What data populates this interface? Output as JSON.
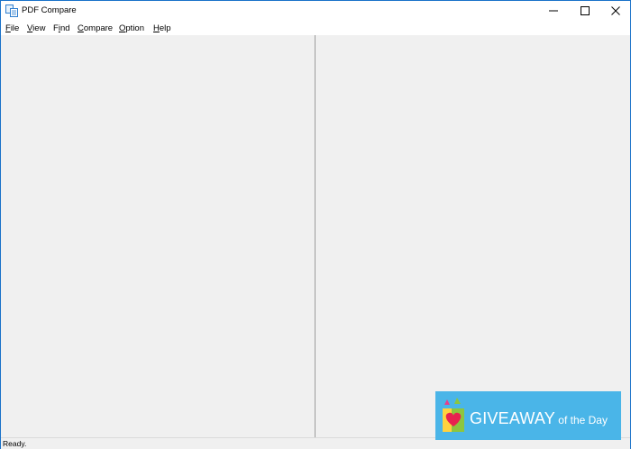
{
  "window": {
    "title": "PDF Compare",
    "accent_color": "#1a72c9",
    "app_icon": "pdf-compare-app-icon",
    "controls": [
      "minimize-icon",
      "maximize-icon",
      "close-icon"
    ]
  },
  "menu": {
    "items": [
      {
        "label": "File",
        "key": "F",
        "rest": "ile"
      },
      {
        "label": "View",
        "key": "V",
        "rest": "iew"
      },
      {
        "label": "Find",
        "pre": "F",
        "key": "i",
        "rest": "nd"
      },
      {
        "label": "Compare",
        "key": "C",
        "rest": "ompare"
      },
      {
        "label": "Option",
        "key": "O",
        "rest": "ption"
      },
      {
        "label": "Help",
        "key": "H",
        "rest": "elp"
      }
    ]
  },
  "status": {
    "text": "Ready."
  },
  "overlay": {
    "brand_main": "GIVEAWAY",
    "brand_sub": " of the Day",
    "background": "#4ab5e8"
  }
}
